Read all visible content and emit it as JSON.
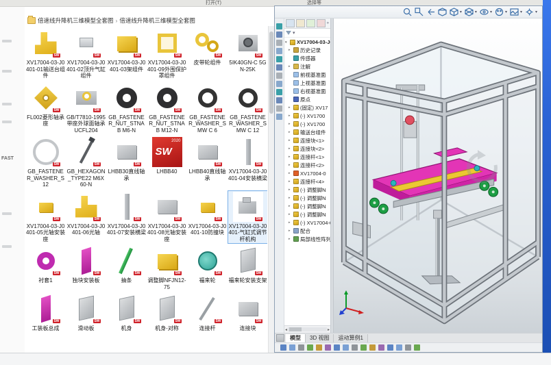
{
  "top_bar": {
    "items": [
      "打开(T)",
      "选择等"
    ]
  },
  "left_strip": {
    "label": "FAST"
  },
  "explorer": {
    "breadcrumb": [
      "倍速线升降机三维模型全套图",
      "倍速线升降机三维模型全套图"
    ],
    "breadcrumb_separator": "›",
    "badge_text": "SW",
    "items": [
      {
        "label": "XV17004-03-J0401-01输送台组件",
        "thumb": "yellow-step",
        "sw": true
      },
      {
        "label": "XV17004-03-J0401-02顶升气缸组件",
        "thumb": "gray-bracket",
        "sw": true
      },
      {
        "label": "XV17004-03-J0401-03架组件",
        "thumb": "yellow-block",
        "sw": true
      },
      {
        "label": "XV17004-03-J0401-09外围保护罩组件",
        "thumb": "yellow-frame",
        "sw": true
      },
      {
        "label": "皮带轮组件",
        "thumb": "pulleys",
        "sw": true
      },
      {
        "label": "5IK40GN-C 5GN-25K",
        "thumb": "motor",
        "sw": true
      },
      {
        "label": "FL002菱形轴承座",
        "thumb": "flange",
        "sw": true
      },
      {
        "label": "GB/T7810-1995带座外球面轴承UCFL204",
        "thumb": "bearing",
        "sw": true
      },
      {
        "label": "GB_FASTENER_NUT_STNAB M6-N",
        "thumb": "nut",
        "sw": true
      },
      {
        "label": "GB_FASTENER_NUT_STNAB M12-N",
        "thumb": "nut",
        "sw": true
      },
      {
        "label": "GB_FASTENER_WASHER_SMW C 6",
        "thumb": "washer",
        "sw": true
      },
      {
        "label": "GB_FASTENER_WASHER_SMW C 12",
        "thumb": "washer",
        "sw": true
      },
      {
        "label": "GB_FASTENER_WASHER_S 12",
        "thumb": "ring-light",
        "sw": true
      },
      {
        "label": "GB_HEXAGON_TYPE22 M6X60-N",
        "thumb": "screw",
        "sw": true
      },
      {
        "label": "LHBB30直线轴承",
        "thumb": "gray-block",
        "sw": true
      },
      {
        "label": "LHBB40",
        "thumb": "sw-logo",
        "sw": false,
        "logo_text": "SW",
        "logo_year": "2020"
      },
      {
        "label": "LHBB40直线轴承",
        "thumb": "gray-block",
        "sw": true
      },
      {
        "label": "XV17004-03-J0401-04安装横梁",
        "thumb": "gray-bar-v",
        "sw": true
      },
      {
        "label": "XV17004-03-J0401-05光轴安装座",
        "thumb": "yellow-small",
        "sw": true
      },
      {
        "label": "XV17004-03-J0401-06光轴",
        "thumb": "yellow-step",
        "sw": true
      },
      {
        "label": "XV17004-03-J0401-07安装横梁",
        "thumb": "gray-bar-v",
        "sw": true
      },
      {
        "label": "XV17004-03-J0401-08光轴安装座",
        "thumb": "gray-block",
        "sw": true
      },
      {
        "label": "XV17004-03-J0401-10防撞块",
        "thumb": "yellow-small",
        "sw": true
      },
      {
        "label": "XV17004-03-J0401-气缸式调节杆机构",
        "thumb": "gray-assembly",
        "sw": true,
        "selected": true
      },
      {
        "label": "衬套1",
        "thumb": "magenta-ring",
        "sw": true
      },
      {
        "label": "独块安装板",
        "thumb": "magenta-plate",
        "sw": true
      },
      {
        "label": "抽条",
        "thumb": "green-rod",
        "sw": true
      },
      {
        "label": "调整脚NFJN12-75",
        "thumb": "yellow-block",
        "sw": true
      },
      {
        "label": "福来轮",
        "thumb": "teal-wheel",
        "sw": true
      },
      {
        "label": "福来轮安装支架",
        "thumb": "gray-plate",
        "sw": true
      },
      {
        "label": "工装板总成",
        "thumb": "magenta-plate",
        "sw": true
      },
      {
        "label": "滑动板",
        "thumb": "gray-plate",
        "sw": true
      },
      {
        "label": "机身",
        "thumb": "gray-plate",
        "sw": true
      },
      {
        "label": "机身-对称",
        "thumb": "gray-plate",
        "sw": true
      },
      {
        "label": "连接杆",
        "thumb": "gray-rod",
        "sw": true
      },
      {
        "label": "连接块",
        "thumb": "gray-block",
        "sw": true
      }
    ]
  },
  "feature_tree": {
    "root": "XV17004-03-J0",
    "tabs": [
      "featuremanager-tab",
      "propertymanager-tab",
      "configurationmanager-tab",
      "dimxpert-tab"
    ],
    "nodes": [
      {
        "label": "历史记录",
        "icon": "history",
        "expandable": true
      },
      {
        "label": "传感器",
        "icon": "sensor",
        "expandable": false
      },
      {
        "label": "注解",
        "icon": "annotation",
        "expandable": true
      },
      {
        "label": "前视基准面",
        "icon": "plane",
        "expandable": false
      },
      {
        "label": "上视基准面",
        "icon": "plane",
        "expandable": false
      },
      {
        "label": "右视基准面",
        "icon": "plane",
        "expandable": false
      },
      {
        "label": "原点",
        "icon": "origin",
        "expandable": false
      },
      {
        "label": "(固定) XV17",
        "icon": "part",
        "expandable": true
      },
      {
        "label": "(-) XV1700",
        "icon": "part",
        "expandable": true
      },
      {
        "label": "(-) XV1700",
        "icon": "part",
        "expandable": true
      },
      {
        "label": "输送台组件",
        "icon": "part",
        "expandable": true
      },
      {
        "label": "连接块<1>",
        "icon": "part",
        "expandable": true
      },
      {
        "label": "连接块<2>",
        "icon": "part",
        "expandable": true
      },
      {
        "label": "连接杆<1>",
        "icon": "part",
        "expandable": true
      },
      {
        "label": "连接杆<2>",
        "icon": "part",
        "expandable": true
      },
      {
        "label": "XV17004-0",
        "icon": "part-red",
        "expandable": true
      },
      {
        "label": "连接杆<4>",
        "icon": "part",
        "expandable": true
      },
      {
        "label": "(-) 调整脚N",
        "icon": "part",
        "expandable": true
      },
      {
        "label": "(-) 调整脚N",
        "icon": "part",
        "expandable": true
      },
      {
        "label": "(-) 调整脚N",
        "icon": "part",
        "expandable": true
      },
      {
        "label": "(-) 调整脚N",
        "icon": "part",
        "expandable": true
      },
      {
        "label": "(-) XV17004-0",
        "icon": "part",
        "expandable": true
      },
      {
        "label": "配合",
        "icon": "mates",
        "expandable": true
      },
      {
        "label": "局部线性阵列",
        "icon": "pattern",
        "expandable": true
      }
    ]
  },
  "hud": {
    "icons": [
      "zoom-fit",
      "zoom-area",
      "previous-view",
      "section-view",
      "view-orientation",
      "display-style",
      "hide-show-items",
      "edit-appearance",
      "apply-scene",
      "view-settings"
    ]
  },
  "side_dock": {
    "icon_count": 12
  },
  "status_bar": {
    "tool_count": 16
  },
  "document_tabs": {
    "tabs": [
      "模型",
      "3D 视图",
      "运动算例1"
    ],
    "active": "模型"
  },
  "colors": {
    "accent_blue": "#2a6ae8",
    "sw_red": "#cf2028",
    "part_yellow": "#f0c52c",
    "part_magenta": "#e032b4",
    "part_green": "#1d9e44",
    "part_teal": "#3cb8a8",
    "desktop_blue": "#2f6fe4"
  }
}
